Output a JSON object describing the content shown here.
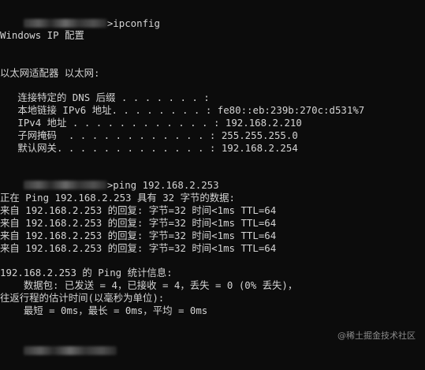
{
  "terminal": {
    "prompt1_cmd": ">ipconfig",
    "win_ip_config": "Windows IP 配置",
    "adapter_title": "以太网适配器 以太网:",
    "dns_suffix": "   连接特定的 DNS 后缀 . . . . . . . :",
    "ipv6": "   本地链接 IPv6 地址. . . . . . . . : fe80::eb:239b:270c:d531%7",
    "ipv4": "   IPv4 地址 . . . . . . . . . . . . : 192.168.2.210",
    "subnet": "   子网掩码  . . . . . . . . . . . . : 255.255.255.0",
    "gateway": "   默认网关. . . . . . . . . . . . . : 192.168.2.254",
    "prompt2_cmd": ">ping 192.168.2.253",
    "ping_header": "正在 Ping 192.168.2.253 具有 32 字节的数据:",
    "replies": [
      "来自 192.168.2.253 的回复: 字节=32 时间<1ms TTL=64",
      "来自 192.168.2.253 的回复: 字节=32 时间<1ms TTL=64",
      "来自 192.168.2.253 的回复: 字节=32 时间<1ms TTL=64",
      "来自 192.168.2.253 的回复: 字节=32 时间<1ms TTL=64"
    ],
    "stats_title": "192.168.2.253 的 Ping 统计信息:",
    "stats_packets": "    数据包: 已发送 = 4，已接收 = 4，丢失 = 0 (0% 丢失)，",
    "rtt_title": "往返行程的估计时间(以毫秒为单位):",
    "rtt_values": "    最短 = 0ms，最长 = 0ms，平均 = 0ms"
  },
  "watermark": {
    "text": "@稀土掘金技术社区"
  }
}
